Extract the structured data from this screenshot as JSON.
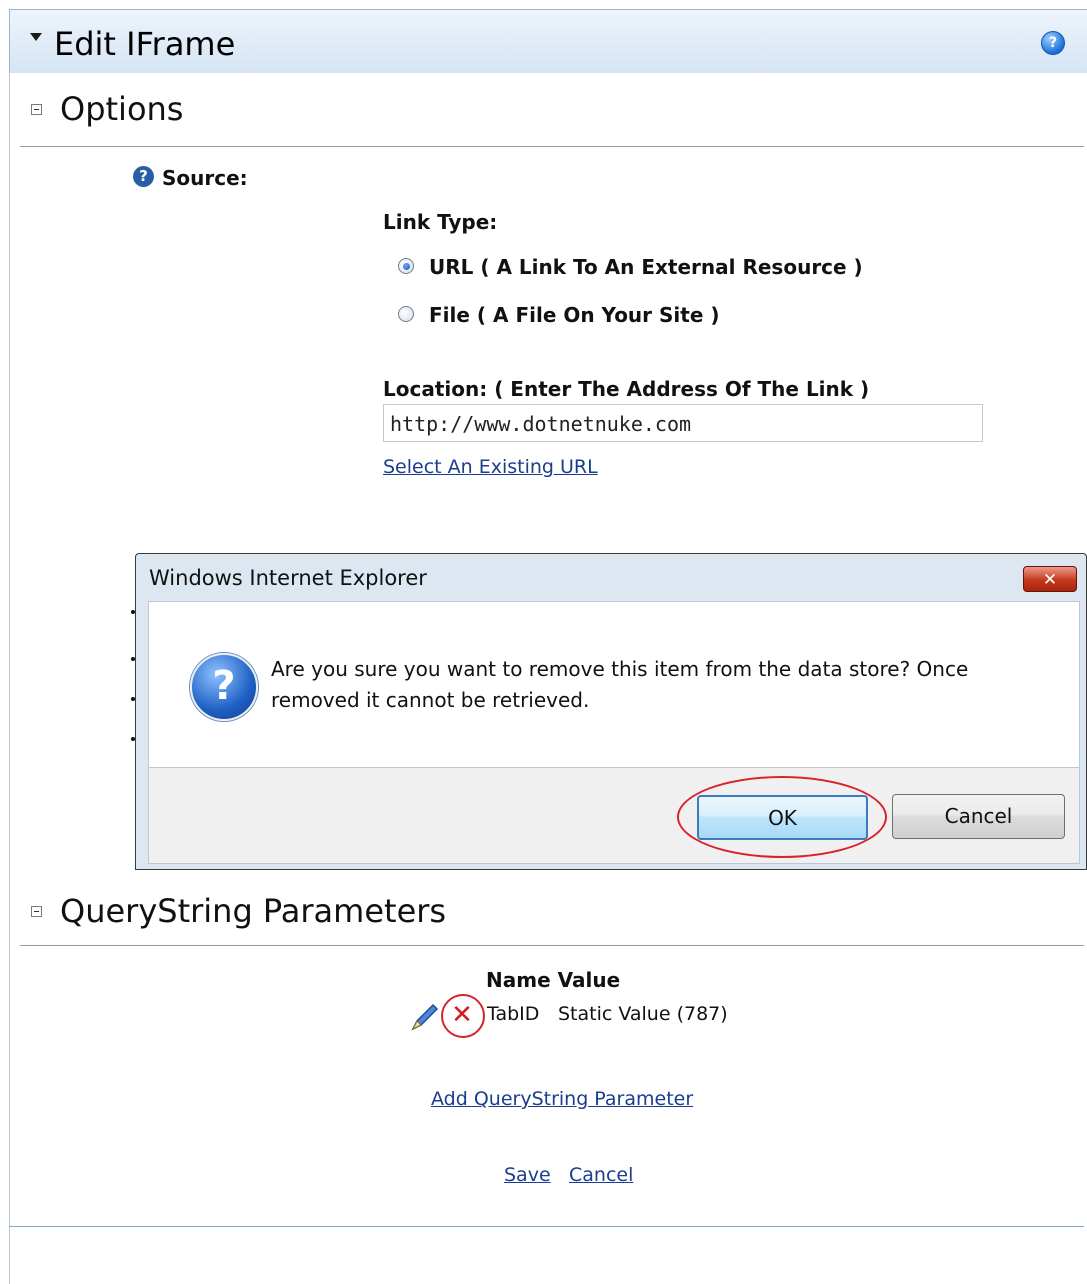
{
  "header": {
    "title": "Edit IFrame",
    "help_icon": "help-circle-icon"
  },
  "options": {
    "title": "Options",
    "source_label": "Source:",
    "link_type_label": "Link Type:",
    "radio_url": "URL ( A Link To An External Resource )",
    "radio_file": "File ( A File On Your Site )",
    "selected": "url",
    "location_label": "Location: ( Enter The Address Of The Link )",
    "location_value": "http://www.dotnetnuke.com",
    "select_existing": "Select An Existing URL"
  },
  "dialog": {
    "title": "Windows Internet Explorer",
    "close_label": "✕",
    "message": "Are you sure you want to remove this item from the data store? Once removed it cannot be retrieved.",
    "ok_label": "OK",
    "cancel_label": "Cancel",
    "icon": "question-icon"
  },
  "querystring": {
    "title": "QueryString Parameters",
    "header": "Name Value",
    "row_name": "TabID",
    "row_value": "Static Value (787)",
    "add_link": "Add QueryString Parameter",
    "save_link": "Save",
    "cancel_link": "Cancel"
  },
  "colors": {
    "accent_red": "#d8232a",
    "link": "#1a3d8f"
  }
}
